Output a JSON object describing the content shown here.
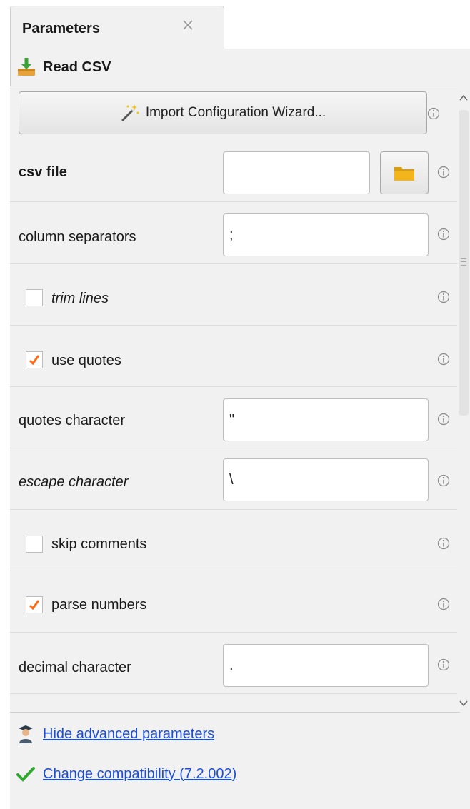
{
  "tab": {
    "title": "Parameters"
  },
  "operator": {
    "title": "Read CSV"
  },
  "wizard": {
    "label": "Import Configuration Wizard..."
  },
  "params": {
    "csv_file": {
      "label": "csv file",
      "value": ""
    },
    "column_separators": {
      "label": "column separators",
      "value": ";"
    },
    "trim_lines": {
      "label": "trim lines",
      "checked": false
    },
    "use_quotes": {
      "label": "use quotes",
      "checked": true
    },
    "quotes_character": {
      "label": "quotes character",
      "value": "\""
    },
    "escape_character": {
      "label": "escape character",
      "value": "\\"
    },
    "skip_comments": {
      "label": "skip comments",
      "checked": false
    },
    "parse_numbers": {
      "label": "parse numbers",
      "checked": true
    },
    "decimal_character": {
      "label": "decimal character",
      "value": "."
    }
  },
  "footer": {
    "hide_advanced": "Hide advanced parameters",
    "compatibility": "Change compatibility (7.2.002)"
  },
  "colors": {
    "panel_bg": "#f1f1f1",
    "link": "#1a4ed8",
    "checkmark": "#ff6a13",
    "folder": "#f2b51c"
  },
  "icons": [
    "close-icon",
    "read-csv-icon",
    "magic-wand-icon",
    "folder-icon",
    "info-icon",
    "checkmark-icon",
    "scroll-up-icon",
    "scroll-down-icon",
    "advanced-user-icon",
    "green-check-icon"
  ]
}
